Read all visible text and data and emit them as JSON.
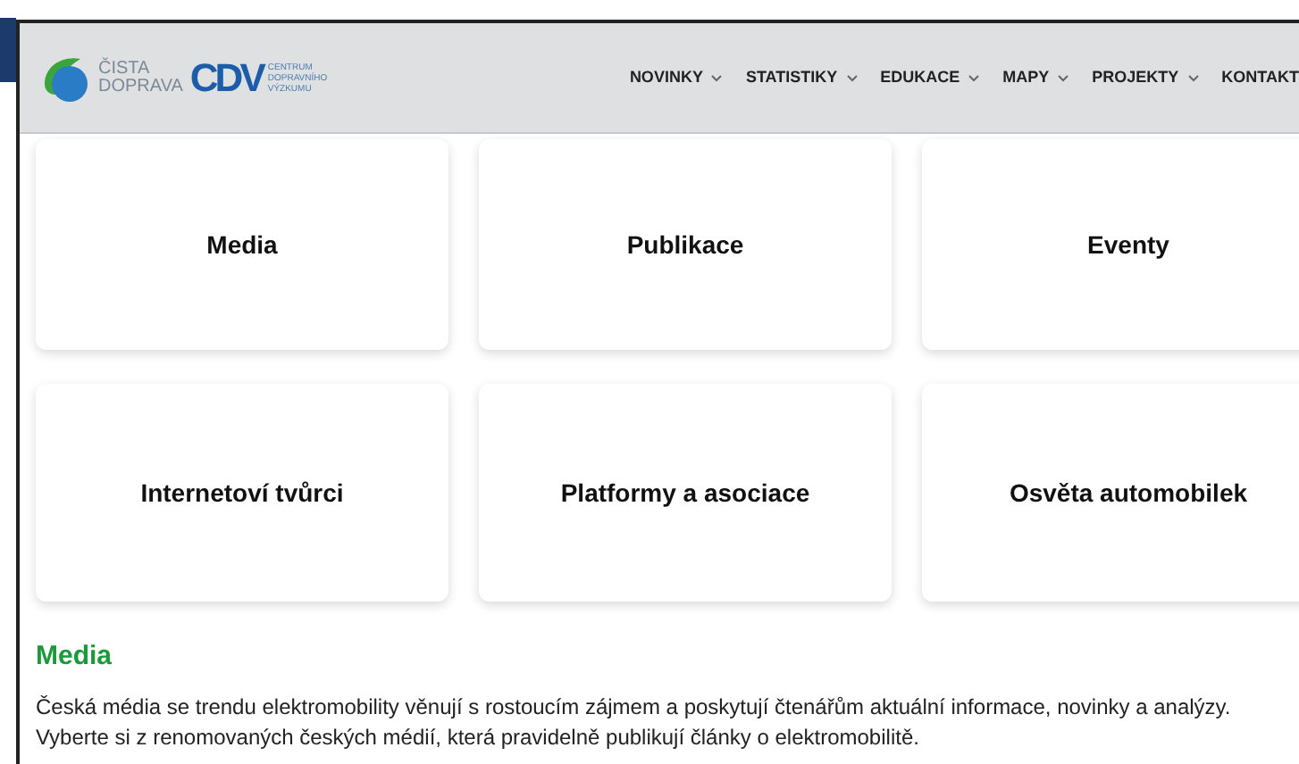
{
  "header": {
    "logo_text": [
      "ČISTA",
      "DOPRAVA"
    ],
    "cdv_logo": "CDV",
    "cdv_text": [
      "CENTRUM",
      "DOPRAVNÍHO",
      "VÝZKUMU"
    ],
    "nav": [
      {
        "label": "NOVINKY",
        "dropdown": true
      },
      {
        "label": "STATISTIKY",
        "dropdown": true
      },
      {
        "label": "EDUKACE",
        "dropdown": true
      },
      {
        "label": "MAPY",
        "dropdown": true
      },
      {
        "label": "PROJEKTY",
        "dropdown": true
      },
      {
        "label": "KONTAKT",
        "dropdown": false
      }
    ]
  },
  "cards": [
    "Media",
    "Publikace",
    "Eventy",
    "Internetoví tvůrci",
    "Platformy a asociace",
    "Osvěta automobilek"
  ],
  "section": {
    "title": "Media",
    "text": "Česká média se trendu elektromobility věnují s rostoucím zájmem a poskytují čtenářům aktuální informace, novinky a analýzy. Vyberte si z renomovaných českých médií, která pravidelně publikují články o elektromobilitě."
  }
}
